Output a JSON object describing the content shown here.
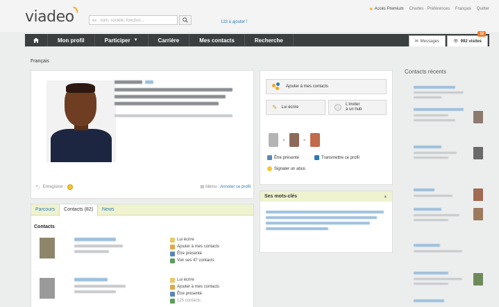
{
  "header": {
    "logo": "viadeo",
    "search_placeholder": "ex : nom, société, fonction...",
    "add_contact_link": "123 à ajouter !",
    "links": [
      "Accès Premium",
      "Charles · Préférences",
      "Français",
      "Quitter"
    ]
  },
  "nav": {
    "items": [
      "Mon profil",
      "Participer",
      "Carrière",
      "Mes contacts",
      "Recherche"
    ],
    "messages": "Messages",
    "visits": "992 visites",
    "visits_badge": "12"
  },
  "language": "Français",
  "profile": {
    "save_label": "Enregistrer :",
    "memo_label": "Mémo :",
    "annotate_link": "Annoter ce profil"
  },
  "tabs": {
    "items": [
      "Parcours",
      "Contacts (82)",
      "News"
    ],
    "active": "Contacts (82)"
  },
  "contacts": {
    "title": "Contacts",
    "first": {
      "actions": [
        "Lui écrire",
        "Ajouter à mes contacts",
        "Être présenté",
        "Voir ses 47 contacts"
      ]
    },
    "second": {
      "actions": [
        "Lui écrire",
        "Ajouter à mes contacts",
        "Être présenté",
        "125 contacts"
      ]
    }
  },
  "actions": {
    "add_contact": "Ajouter à mes contacts",
    "write": "Lui écrire",
    "invite_line1": "L'inviter",
    "invite_line2": "à un hub",
    "be_introduced": "Être présenté",
    "forward_profile": "Transmettre ce profil",
    "report_abuse": "Signaler un abus"
  },
  "keywords": {
    "title": "Ses mots-clés"
  },
  "recent": {
    "title": "Contacts récents"
  },
  "colors": {
    "nav_bg": "#3b3f40",
    "link": "#2a7ab8",
    "tab_bar": "#eff3cf",
    "accent": "#f6a623"
  }
}
